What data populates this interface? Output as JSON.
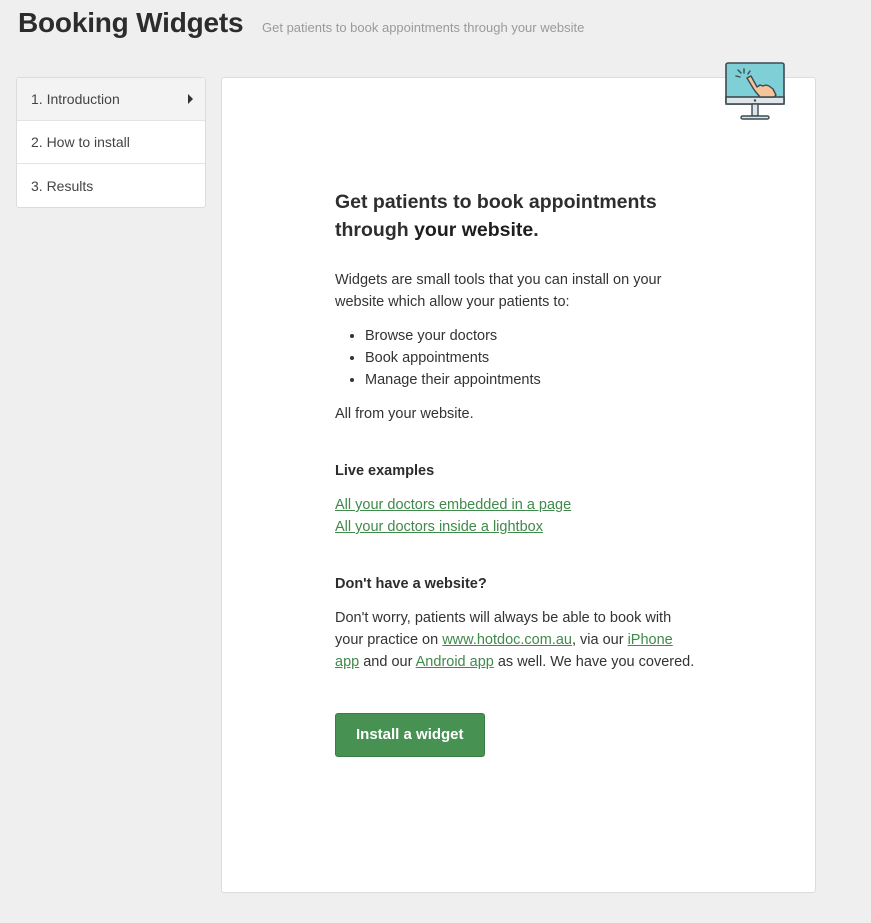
{
  "header": {
    "title": "Booking Widgets",
    "subtitle": "Get patients to book appointments through your website"
  },
  "sidebar": {
    "items": [
      {
        "label": "1. Introduction",
        "active": true
      },
      {
        "label": "2. How to install",
        "active": false
      },
      {
        "label": "3. Results",
        "active": false
      }
    ]
  },
  "main": {
    "icon": "monitor-click-icon",
    "headline_part1": "Get patients to book appointments through ",
    "headline_part2": "your website",
    "headline_part3": ".",
    "intro": "Widgets are small tools that you can install on your website which allow your patients to:",
    "bullets": [
      "Browse your doctors",
      "Book appointments",
      "Manage their appointments"
    ],
    "outro": "All from your website.",
    "live_examples_heading": "Live examples",
    "example_links": [
      "All your doctors embedded in a page",
      "All your doctors inside a lightbox"
    ],
    "no_website_heading": "Don't have a website?",
    "no_website_text_1": "Don't worry, patients will always be able to book with your practice on ",
    "hotdoc_link": "www.hotdoc.com.au",
    "no_website_text_2": ", via our ",
    "iphone_link": "iPhone app",
    "no_website_text_3": " and our ",
    "android_link": "Android app",
    "no_website_text_4": " as well. We have you covered.",
    "install_button": "Install a widget"
  },
  "colors": {
    "accent": "#479253",
    "link": "#3f8a4a",
    "background": "#efefef"
  }
}
